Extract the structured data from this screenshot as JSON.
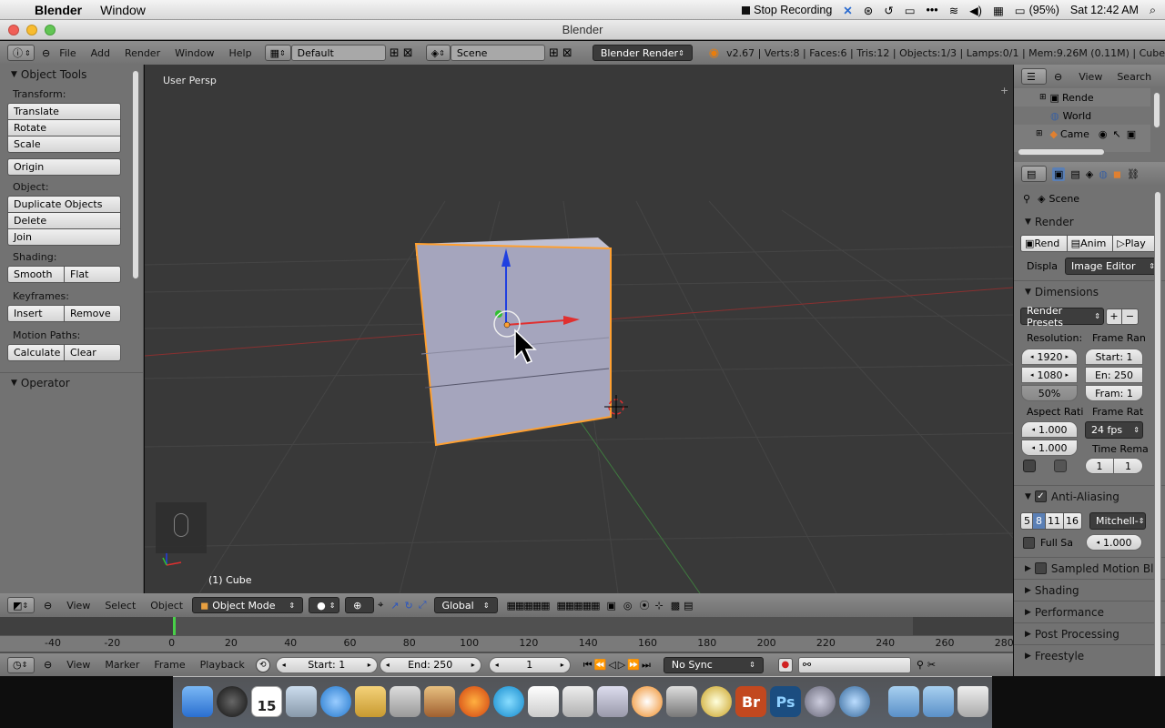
{
  "menubar": {
    "app_name": "Blender",
    "items": [
      "Window"
    ],
    "recording": "Stop Recording",
    "battery": "(95%)",
    "clock": "Sat 12:42 AM"
  },
  "window": {
    "title": "Blender"
  },
  "info_header": {
    "menus": [
      "File",
      "Add",
      "Render",
      "Window",
      "Help"
    ],
    "screen_layout": "Default",
    "scene": "Scene",
    "engine": "Blender Render",
    "stats": "v2.67 | Verts:8 | Faces:6 | Tris:12 | Objects:1/3 | Lamps:0/1 | Mem:9.26M (0.11M) | Cube"
  },
  "toolshelf": {
    "title": "Object Tools",
    "transform_label": "Transform:",
    "translate": "Translate",
    "rotate": "Rotate",
    "scale": "Scale",
    "origin": "Origin",
    "object_label": "Object:",
    "duplicate": "Duplicate Objects",
    "delete": "Delete",
    "join": "Join",
    "shading_label": "Shading:",
    "smooth": "Smooth",
    "flat": "Flat",
    "keyframes_label": "Keyframes:",
    "insert": "Insert",
    "remove": "Remove",
    "motion_label": "Motion Paths:",
    "calculate": "Calculate",
    "clear": "Clear",
    "operator": "Operator"
  },
  "viewport": {
    "view_name": "User Persp",
    "object_name": "(1) Cube"
  },
  "view3d_header": {
    "menus": [
      "View",
      "Select",
      "Object"
    ],
    "mode": "Object Mode",
    "orientation": "Global"
  },
  "timeline": {
    "ticks": [
      "-40",
      "-20",
      "0",
      "20",
      "40",
      "60",
      "80",
      "100",
      "120",
      "140",
      "160",
      "180",
      "200",
      "220",
      "240",
      "260",
      "280"
    ],
    "menus": [
      "View",
      "Marker",
      "Frame",
      "Playback"
    ],
    "start": "Start: 1",
    "end": "End: 250",
    "current": "1",
    "sync": "No Sync"
  },
  "outliner": {
    "menus": [
      "View",
      "Search"
    ],
    "items": [
      "Rende",
      "World",
      "Came"
    ]
  },
  "properties": {
    "context": "Scene",
    "render_section": "Render",
    "render_btn": "Rend",
    "anim_btn": "Anim",
    "play_btn": "Play",
    "display_label": "Displa",
    "display_value": "Image Editor",
    "dimensions_section": "Dimensions",
    "presets": "Render Presets",
    "resolution_label": "Resolution:",
    "res_x": "1920",
    "res_y": "1080",
    "res_pct": "50%",
    "frame_range_label": "Frame Ran",
    "frame_start": "Start: 1",
    "frame_end": "En: 250",
    "frame_step": "Fram: 1",
    "aspect_label": "Aspect Rati",
    "aspect_x": "1.000",
    "aspect_y": "1.000",
    "frame_rate_label": "Frame Rat",
    "fps": "24 fps",
    "time_remap_label": "Time Rema",
    "remap_old": "1",
    "remap_new": "1",
    "aa_section": "Anti-Aliasing",
    "aa_samples": [
      "5",
      "8",
      "11",
      "16"
    ],
    "aa_filter": "Mitchell-",
    "full_sample": "Full Sa",
    "filter_size": "1.000",
    "collapsed_sections": [
      "Sampled Motion Bl",
      "Shading",
      "Performance",
      "Post Processing"
    ],
    "cut_off_section": "Freestyle"
  },
  "dock": {
    "calendar_day": "15",
    "br_label": "Br",
    "ps_label": "Ps"
  },
  "colors": {
    "ui_panel": "#727272",
    "viewport_bg": "#393939",
    "selection_outline": "#ffa030",
    "axis_x": "#c83030",
    "axis_y": "#30a030",
    "axis_z": "#2040e0",
    "cube_face": "#a5a5bd"
  }
}
